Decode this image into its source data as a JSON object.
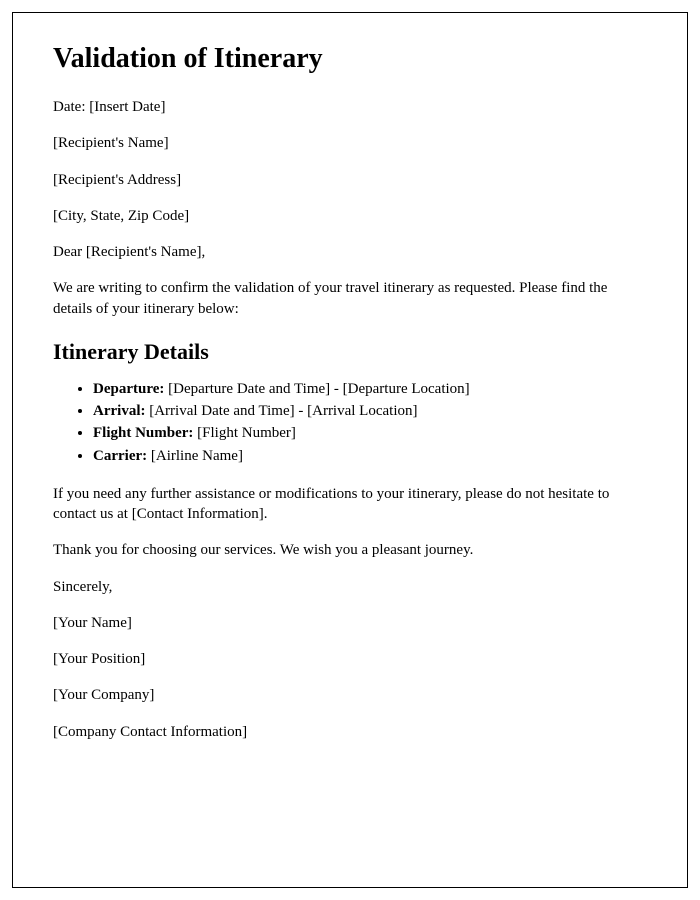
{
  "title": "Validation of Itinerary",
  "date_line": "Date: [Insert Date]",
  "recipient_name": "[Recipient's Name]",
  "recipient_address": "[Recipient's Address]",
  "recipient_city": "[City, State, Zip Code]",
  "salutation": "Dear [Recipient's Name],",
  "intro": "We are writing to confirm the validation of your travel itinerary as requested. Please find the details of your itinerary below:",
  "details_heading": "Itinerary Details",
  "details": {
    "departure_label": "Departure:",
    "departure_value": " [Departure Date and Time] - [Departure Location]",
    "arrival_label": "Arrival:",
    "arrival_value": " [Arrival Date and Time] - [Arrival Location]",
    "flight_label": "Flight Number:",
    "flight_value": " [Flight Number]",
    "carrier_label": "Carrier:",
    "carrier_value": " [Airline Name]"
  },
  "assistance": "If you need any further assistance or modifications to your itinerary, please do not hesitate to contact us at [Contact Information].",
  "thanks": "Thank you for choosing our services. We wish you a pleasant journey.",
  "closing": "Sincerely,",
  "sender_name": "[Your Name]",
  "sender_position": "[Your Position]",
  "sender_company": "[Your Company]",
  "sender_contact": "[Company Contact Information]"
}
